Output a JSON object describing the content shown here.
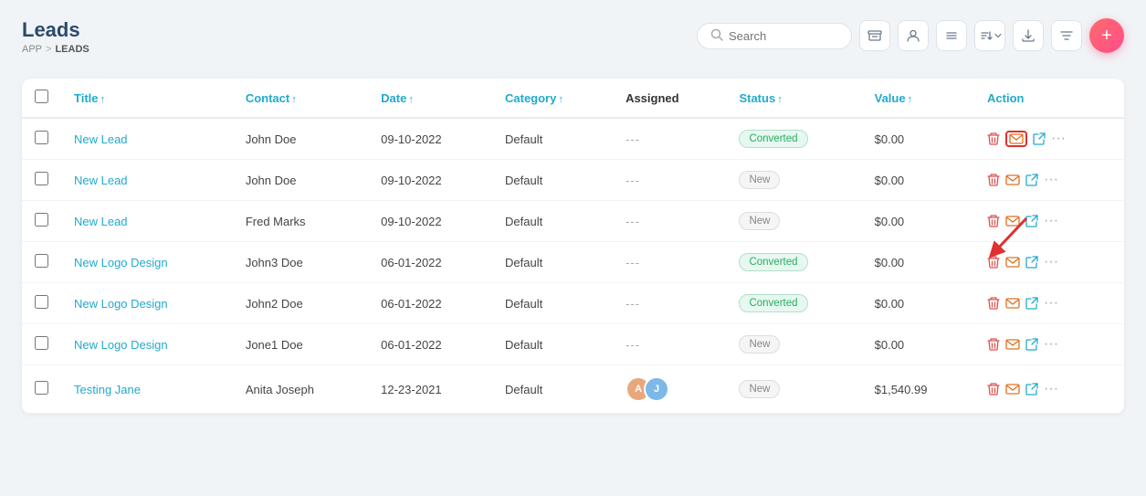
{
  "page": {
    "title": "Leads",
    "breadcrumb": {
      "app": "APP",
      "separator": ">",
      "current": "LEADS"
    }
  },
  "toolbar": {
    "search_placeholder": "Search",
    "add_button_label": "+"
  },
  "table": {
    "columns": [
      {
        "key": "checkbox",
        "label": ""
      },
      {
        "key": "title",
        "label": "Title",
        "sortable": true
      },
      {
        "key": "contact",
        "label": "Contact",
        "sortable": true
      },
      {
        "key": "date",
        "label": "Date",
        "sortable": true
      },
      {
        "key": "category",
        "label": "Category",
        "sortable": true
      },
      {
        "key": "assigned",
        "label": "Assigned",
        "sortable": false
      },
      {
        "key": "status",
        "label": "Status",
        "sortable": true
      },
      {
        "key": "value",
        "label": "Value",
        "sortable": true
      },
      {
        "key": "action",
        "label": "Action",
        "sortable": false
      }
    ],
    "rows": [
      {
        "id": 1,
        "title": "New Lead",
        "contact": "John Doe",
        "date": "09-10-2022",
        "category": "Default",
        "assigned": "---",
        "status": "Converted",
        "status_type": "converted",
        "value": "$0.00",
        "highlighted": true
      },
      {
        "id": 2,
        "title": "New Lead",
        "contact": "John Doe",
        "date": "09-10-2022",
        "category": "Default",
        "assigned": "---",
        "status": "New",
        "status_type": "new",
        "value": "$0.00",
        "highlighted": false
      },
      {
        "id": 3,
        "title": "New Lead",
        "contact": "Fred Marks",
        "date": "09-10-2022",
        "category": "Default",
        "assigned": "---",
        "status": "New",
        "status_type": "new",
        "value": "$0.00",
        "highlighted": false
      },
      {
        "id": 4,
        "title": "New Logo Design",
        "contact": "John3 Doe",
        "date": "06-01-2022",
        "category": "Default",
        "assigned": "---",
        "status": "Converted",
        "status_type": "converted",
        "value": "$0.00",
        "highlighted": false
      },
      {
        "id": 5,
        "title": "New Logo Design",
        "contact": "John2 Doe",
        "date": "06-01-2022",
        "category": "Default",
        "assigned": "---",
        "status": "Converted",
        "status_type": "converted",
        "value": "$0.00",
        "highlighted": false
      },
      {
        "id": 6,
        "title": "New Logo Design",
        "contact": "Jone1 Doe",
        "date": "06-01-2022",
        "category": "Default",
        "assigned": "---",
        "status": "New",
        "status_type": "new",
        "value": "$0.00",
        "highlighted": false
      },
      {
        "id": 7,
        "title": "Testing Jane",
        "contact": "Anita Joseph",
        "date": "12-23-2021",
        "category": "Default",
        "assigned": "avatars",
        "status": "New",
        "status_type": "new",
        "value": "$1,540.99",
        "highlighted": false
      }
    ]
  }
}
